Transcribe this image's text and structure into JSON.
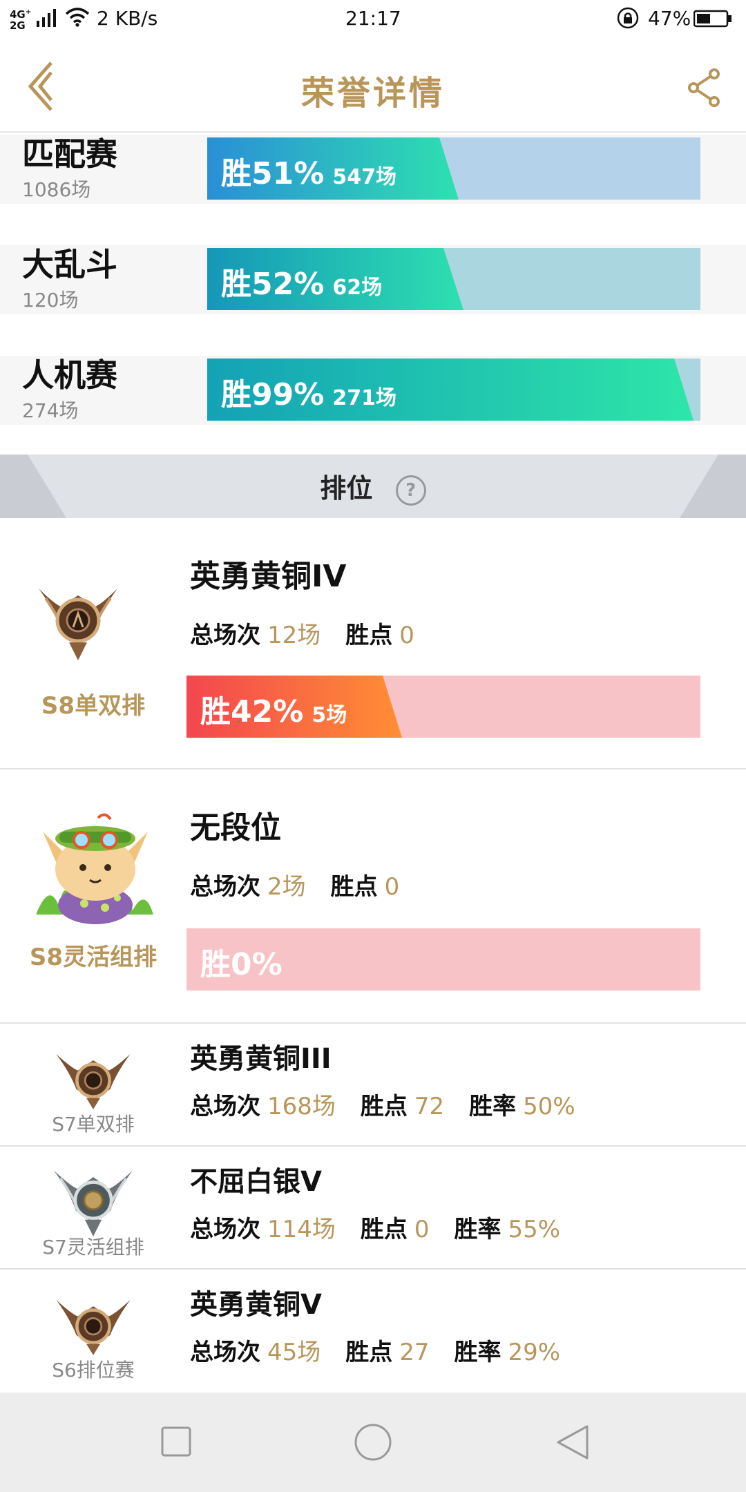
{
  "status_bar": {
    "network": "4G+\n2G",
    "speed": "2 KB/s",
    "time": "21:17",
    "battery": "47%"
  },
  "header": {
    "title": "荣誉详情"
  },
  "modes": [
    {
      "name": "匹配赛",
      "count": "1086场",
      "win_label": "胜51%",
      "games": "547场",
      "win_rate": 0.51
    },
    {
      "name": "大乱斗",
      "count": "120场",
      "win_label": "胜52%",
      "games": "62场",
      "win_rate": 0.52
    },
    {
      "name": "人机赛",
      "count": "274场",
      "win_label": "胜99%",
      "games": "271场",
      "win_rate": 0.99
    }
  ],
  "ranked_section": {
    "label": "排位",
    "help_icon": "?"
  },
  "ranked_large": [
    {
      "rank": "英勇黄铜IV",
      "season": "S8单双排",
      "total_label": "总场次",
      "total": "12场",
      "points_label": "胜点",
      "points": "0",
      "win_label": "胜42%",
      "games": "5场",
      "win_rate": 0.42,
      "icon": "bronze-rank-emblem"
    },
    {
      "rank": "无段位",
      "season": "S8灵活组排",
      "total_label": "总场次",
      "total": "2场",
      "points_label": "胜点",
      "points": "0",
      "win_label": "胜0%",
      "games": "",
      "win_rate": 0,
      "icon": "teemo-avatar"
    }
  ],
  "ranked_small": [
    {
      "rank": "英勇黄铜III",
      "season": "S7单双排",
      "total_label": "总场次",
      "total": "168场",
      "points_label": "胜点",
      "points": "72",
      "rate_label": "胜率",
      "rate": "50%",
      "icon": "bronze-rank-emblem"
    },
    {
      "rank": "不屈白银V",
      "season": "S7灵活组排",
      "total_label": "总场次",
      "total": "114场",
      "points_label": "胜点",
      "points": "0",
      "rate_label": "胜率",
      "rate": "55%",
      "icon": "silver-rank-emblem"
    },
    {
      "rank": "英勇黄铜V",
      "season": "S6排位赛",
      "total_label": "总场次",
      "total": "45场",
      "points_label": "胜点",
      "points": "27",
      "rate_label": "胜率",
      "rate": "29%",
      "icon": "bronze-rank-emblem"
    }
  ],
  "colors": {
    "accent_gold": "#b8965a",
    "win_blue_start": "#2a8fd6",
    "win_teal_end": "#2ee0b0",
    "win_bg_blue": "#b4d3ea",
    "win_bg_teal": "#a9d6df",
    "loss_red_start": "#f4464f",
    "loss_orange_end": "#ff8f34",
    "loss_bg_pink": "#f7c3c6"
  }
}
